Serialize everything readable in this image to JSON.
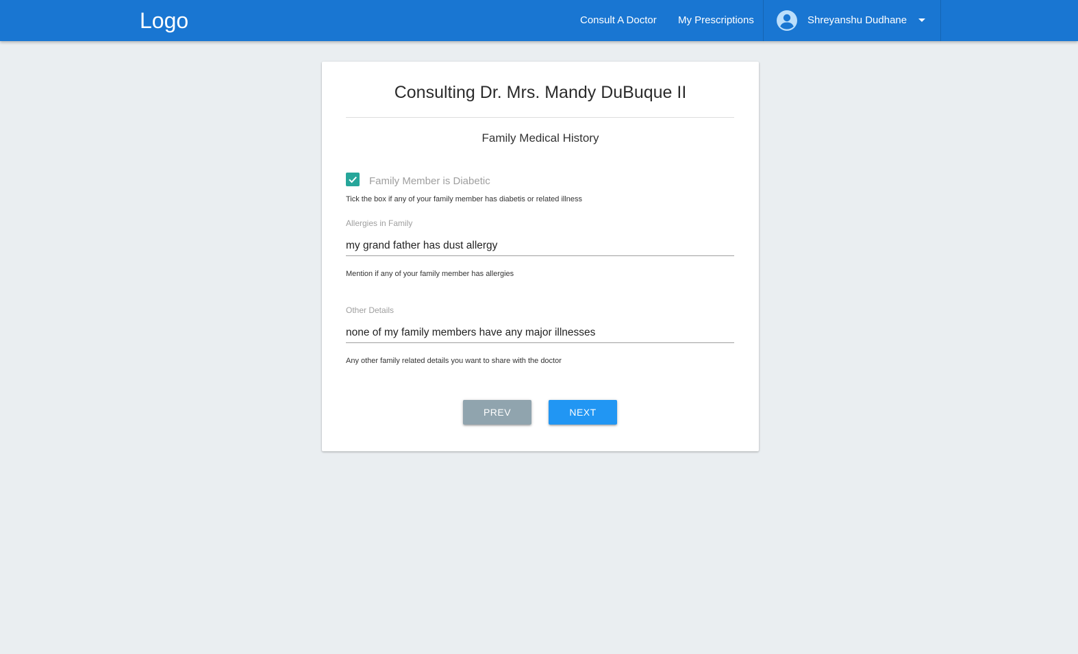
{
  "nav": {
    "logo": "Logo",
    "links": [
      {
        "label": "Consult A Doctor"
      },
      {
        "label": "My Prescriptions"
      }
    ],
    "user": {
      "name": "Shreyanshu Dudhane",
      "avatar_icon": "account-circle-icon",
      "dropdown_icon": "caret-down-icon"
    }
  },
  "card": {
    "title": "Consulting Dr. Mrs. Mandy DuBuque II",
    "section_title": "Family Medical History",
    "diabetic": {
      "checked": true,
      "label": "Family Member is Diabetic",
      "helper": "Tick the box if any of your family member has diabetis or related illness"
    },
    "allergies": {
      "label": "Allergies in Family",
      "value": "my grand father has dust allergy",
      "helper": "Mention if any of your family member has allergies"
    },
    "other": {
      "label": "Other Details",
      "value": "none of my family members have any major illnesses",
      "helper": "Any other family related details you want to share with the doctor"
    },
    "buttons": {
      "prev": "PREV",
      "next": "NEXT"
    }
  },
  "colors": {
    "navbar": "#1976d2",
    "background": "#eaeef1",
    "checkbox": "#26a69a",
    "prev_button": "#90a4ae",
    "next_button": "#2196f3"
  }
}
